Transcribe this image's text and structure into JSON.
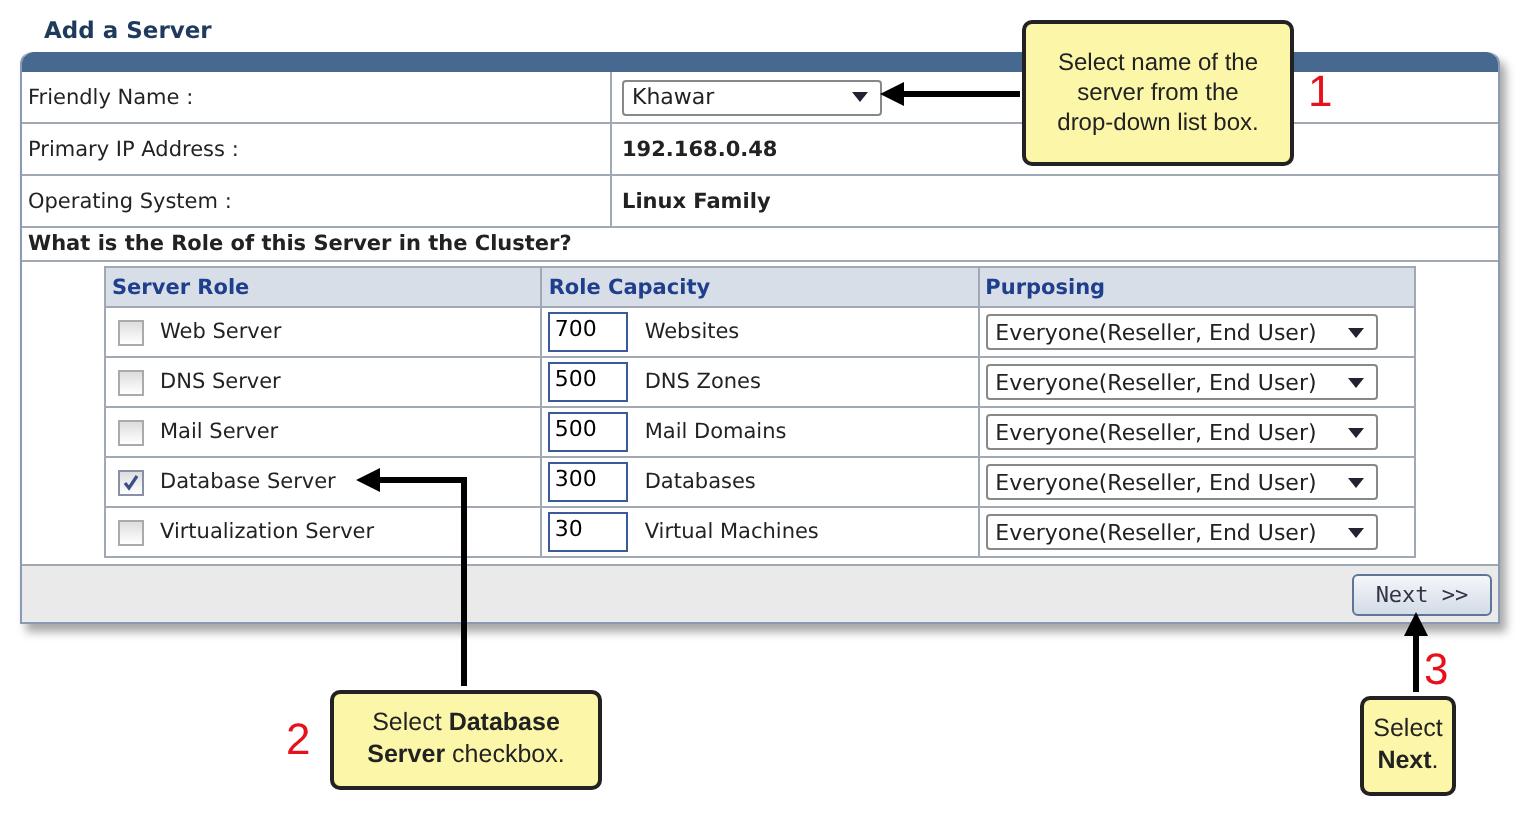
{
  "title": "Add a Server",
  "fields": [
    {
      "label": "Friendly Name :",
      "kind": "select",
      "value": "Khawar"
    },
    {
      "label": "Primary IP Address :",
      "kind": "text",
      "value": "192.168.0.48"
    },
    {
      "label": "Operating System :",
      "kind": "text",
      "value": "Linux Family"
    }
  ],
  "question": "What is the Role of this Server in the Cluster?",
  "roles_table": {
    "columns": [
      "Server Role",
      "Role Capacity",
      "Purposing"
    ],
    "rows": [
      {
        "role": "Web Server",
        "checked": false,
        "capacity": "700",
        "unit": "Websites",
        "purposing": "Everyone(Reseller, End User)"
      },
      {
        "role": "DNS Server",
        "checked": false,
        "capacity": "500",
        "unit": "DNS Zones",
        "purposing": "Everyone(Reseller, End User)"
      },
      {
        "role": "Mail Server",
        "checked": false,
        "capacity": "500",
        "unit": "Mail Domains",
        "purposing": "Everyone(Reseller, End User)"
      },
      {
        "role": "Database Server",
        "checked": true,
        "capacity": "300",
        "unit": "Databases",
        "purposing": "Everyone(Reseller, End User)"
      },
      {
        "role": "Virtualization Server",
        "checked": false,
        "capacity": "30",
        "unit": "Virtual Machines",
        "purposing": "Everyone(Reseller, End User)"
      }
    ]
  },
  "next_button": "Next >>",
  "callouts": [
    {
      "number": "1",
      "text": "Select name of the server from the drop-down list box."
    },
    {
      "number": "2",
      "text": "Select **Database Server** checkbox."
    },
    {
      "number": "3",
      "text": "Select **Next**."
    }
  ]
}
